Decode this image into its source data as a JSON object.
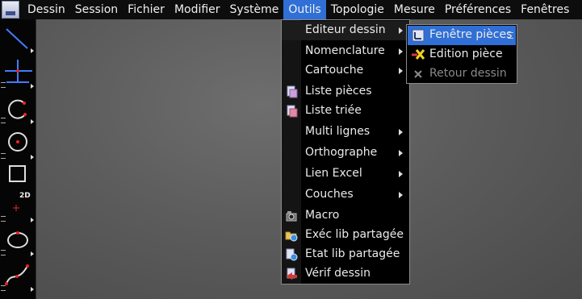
{
  "menubar": {
    "items": [
      "Dessin",
      "Session",
      "Fichier",
      "Modifier",
      "Système",
      "Outils",
      "Topologie",
      "Mesure",
      "Préférences",
      "Fenêtres"
    ],
    "active": "Outils"
  },
  "toolbar": {
    "tools": [
      {
        "name": "line-tool-icon"
      },
      {
        "name": "axis-tool-icon"
      },
      {
        "name": "arc-tool-icon"
      },
      {
        "name": "circle-tool-icon"
      },
      {
        "name": "rectangle-tool-icon"
      },
      {
        "name": "2d-point-tool-icon",
        "text": "2D"
      },
      {
        "name": "ellipse-tool-icon"
      },
      {
        "name": "curve-tool-icon"
      }
    ]
  },
  "outils_menu": {
    "items": [
      {
        "label": "Editeur dessin",
        "submenu": true
      },
      {
        "label": "Nomenclature",
        "submenu": true
      },
      {
        "label": "Cartouche",
        "submenu": true
      },
      {
        "label": "Liste pièces",
        "icon": "parts-list-icon"
      },
      {
        "label": "Liste triée",
        "icon": "sorted-list-icon"
      },
      {
        "label": "Multi lignes",
        "submenu": true
      },
      {
        "label": "Orthographe",
        "submenu": true
      },
      {
        "label": "Lien Excel",
        "submenu": true
      },
      {
        "label": "Couches",
        "submenu": true
      },
      {
        "label": "Macro",
        "icon": "macro-icon"
      },
      {
        "label": "Exéc lib partagée",
        "icon": "execute-shared-lib-icon"
      },
      {
        "label": "Etat lib partagée",
        "icon": "shared-lib-status-icon"
      },
      {
        "label": "Vérif dessin",
        "icon": "check-drawing-icon"
      }
    ]
  },
  "editeur_submenu": {
    "items": [
      {
        "label": "Fenêtre pièces",
        "icon": "parts-window-icon",
        "selected": true
      },
      {
        "label": "Edition pièce",
        "icon": "edit-part-icon"
      },
      {
        "label": "Retour dessin",
        "icon": "return-drawing-icon",
        "disabled": true
      }
    ]
  },
  "colors": {
    "accent": "#2f6fd6",
    "menubar": "#0d0d0d",
    "workspace": "#5c5c5c"
  }
}
